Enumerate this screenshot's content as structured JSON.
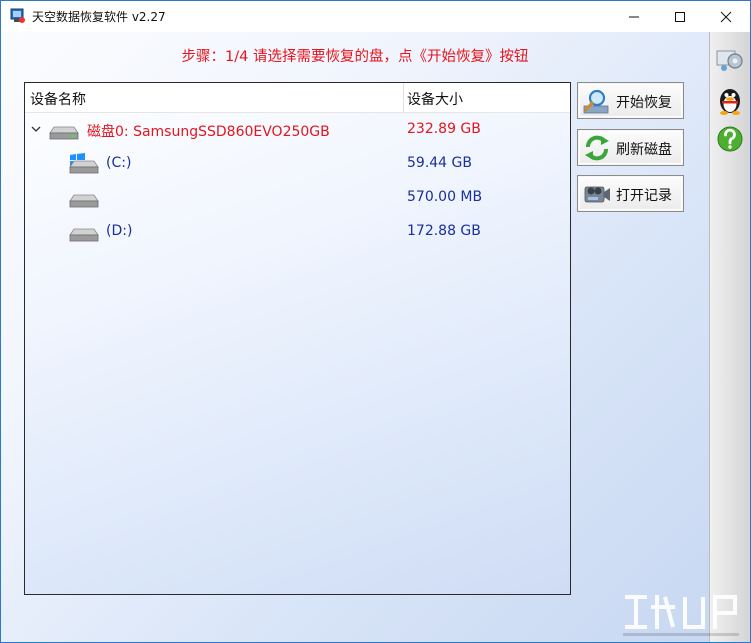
{
  "window": {
    "title": "天空数据恢复软件 v2.27",
    "controls": {
      "minimize": "minimize-icon",
      "maximize": "maximize-icon",
      "close": "close-icon"
    }
  },
  "instruction": "步骤：1/4 请选择需要恢复的盘，点《开始恢复》按钮",
  "device_table": {
    "columns": [
      "设备名称",
      "设备大小"
    ],
    "rows": [
      {
        "name": "磁盘0: SamsungSSD860EVO250GB",
        "size": "232.89 GB",
        "level": 0,
        "icon": "hard-drive-icon",
        "expanded": true
      },
      {
        "name": "(C:)",
        "size": "59.44 GB",
        "level": 1,
        "icon": "windows-logo-icon"
      },
      {
        "name": "",
        "size": "570.00 MB",
        "level": 1,
        "icon": "hard-drive-icon"
      },
      {
        "name": "(D:)",
        "size": "172.88 GB",
        "level": 1,
        "icon": "hard-drive-icon"
      }
    ]
  },
  "actions": [
    {
      "label": "开始恢复",
      "icon": "magnifier-icon"
    },
    {
      "label": "刷新磁盘",
      "icon": "refresh-icon"
    },
    {
      "label": "打开记录",
      "icon": "camcorder-icon"
    }
  ],
  "side_strip": [
    {
      "icon": "settings-icon"
    },
    {
      "icon": "qq-penguin-icon"
    },
    {
      "icon": "help-icon"
    }
  ],
  "colors": {
    "instruction_text": "#e8141c",
    "disk_text": "#e2161f",
    "partition_text": "#1a2f9a",
    "window_border": "#2b79c9"
  }
}
